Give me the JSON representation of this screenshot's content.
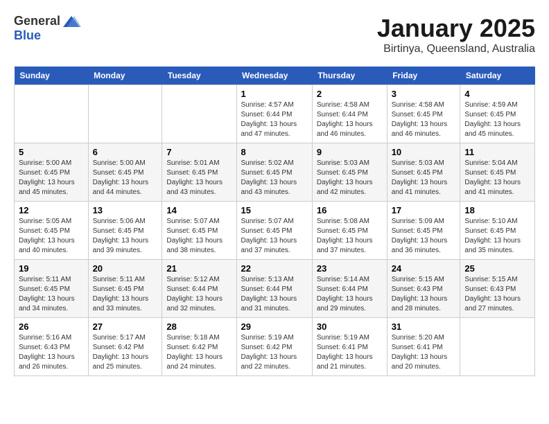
{
  "logo": {
    "general": "General",
    "blue": "Blue"
  },
  "title": "January 2025",
  "subtitle": "Birtinya, Queensland, Australia",
  "weekdays": [
    "Sunday",
    "Monday",
    "Tuesday",
    "Wednesday",
    "Thursday",
    "Friday",
    "Saturday"
  ],
  "weeks": [
    [
      {
        "day": "",
        "info": ""
      },
      {
        "day": "",
        "info": ""
      },
      {
        "day": "",
        "info": ""
      },
      {
        "day": "1",
        "info": "Sunrise: 4:57 AM\nSunset: 6:44 PM\nDaylight: 13 hours and 47 minutes."
      },
      {
        "day": "2",
        "info": "Sunrise: 4:58 AM\nSunset: 6:44 PM\nDaylight: 13 hours and 46 minutes."
      },
      {
        "day": "3",
        "info": "Sunrise: 4:58 AM\nSunset: 6:45 PM\nDaylight: 13 hours and 46 minutes."
      },
      {
        "day": "4",
        "info": "Sunrise: 4:59 AM\nSunset: 6:45 PM\nDaylight: 13 hours and 45 minutes."
      }
    ],
    [
      {
        "day": "5",
        "info": "Sunrise: 5:00 AM\nSunset: 6:45 PM\nDaylight: 13 hours and 45 minutes."
      },
      {
        "day": "6",
        "info": "Sunrise: 5:00 AM\nSunset: 6:45 PM\nDaylight: 13 hours and 44 minutes."
      },
      {
        "day": "7",
        "info": "Sunrise: 5:01 AM\nSunset: 6:45 PM\nDaylight: 13 hours and 43 minutes."
      },
      {
        "day": "8",
        "info": "Sunrise: 5:02 AM\nSunset: 6:45 PM\nDaylight: 13 hours and 43 minutes."
      },
      {
        "day": "9",
        "info": "Sunrise: 5:03 AM\nSunset: 6:45 PM\nDaylight: 13 hours and 42 minutes."
      },
      {
        "day": "10",
        "info": "Sunrise: 5:03 AM\nSunset: 6:45 PM\nDaylight: 13 hours and 41 minutes."
      },
      {
        "day": "11",
        "info": "Sunrise: 5:04 AM\nSunset: 6:45 PM\nDaylight: 13 hours and 41 minutes."
      }
    ],
    [
      {
        "day": "12",
        "info": "Sunrise: 5:05 AM\nSunset: 6:45 PM\nDaylight: 13 hours and 40 minutes."
      },
      {
        "day": "13",
        "info": "Sunrise: 5:06 AM\nSunset: 6:45 PM\nDaylight: 13 hours and 39 minutes."
      },
      {
        "day": "14",
        "info": "Sunrise: 5:07 AM\nSunset: 6:45 PM\nDaylight: 13 hours and 38 minutes."
      },
      {
        "day": "15",
        "info": "Sunrise: 5:07 AM\nSunset: 6:45 PM\nDaylight: 13 hours and 37 minutes."
      },
      {
        "day": "16",
        "info": "Sunrise: 5:08 AM\nSunset: 6:45 PM\nDaylight: 13 hours and 37 minutes."
      },
      {
        "day": "17",
        "info": "Sunrise: 5:09 AM\nSunset: 6:45 PM\nDaylight: 13 hours and 36 minutes."
      },
      {
        "day": "18",
        "info": "Sunrise: 5:10 AM\nSunset: 6:45 PM\nDaylight: 13 hours and 35 minutes."
      }
    ],
    [
      {
        "day": "19",
        "info": "Sunrise: 5:11 AM\nSunset: 6:45 PM\nDaylight: 13 hours and 34 minutes."
      },
      {
        "day": "20",
        "info": "Sunrise: 5:11 AM\nSunset: 6:45 PM\nDaylight: 13 hours and 33 minutes."
      },
      {
        "day": "21",
        "info": "Sunrise: 5:12 AM\nSunset: 6:44 PM\nDaylight: 13 hours and 32 minutes."
      },
      {
        "day": "22",
        "info": "Sunrise: 5:13 AM\nSunset: 6:44 PM\nDaylight: 13 hours and 31 minutes."
      },
      {
        "day": "23",
        "info": "Sunrise: 5:14 AM\nSunset: 6:44 PM\nDaylight: 13 hours and 29 minutes."
      },
      {
        "day": "24",
        "info": "Sunrise: 5:15 AM\nSunset: 6:43 PM\nDaylight: 13 hours and 28 minutes."
      },
      {
        "day": "25",
        "info": "Sunrise: 5:15 AM\nSunset: 6:43 PM\nDaylight: 13 hours and 27 minutes."
      }
    ],
    [
      {
        "day": "26",
        "info": "Sunrise: 5:16 AM\nSunset: 6:43 PM\nDaylight: 13 hours and 26 minutes."
      },
      {
        "day": "27",
        "info": "Sunrise: 5:17 AM\nSunset: 6:42 PM\nDaylight: 13 hours and 25 minutes."
      },
      {
        "day": "28",
        "info": "Sunrise: 5:18 AM\nSunset: 6:42 PM\nDaylight: 13 hours and 24 minutes."
      },
      {
        "day": "29",
        "info": "Sunrise: 5:19 AM\nSunset: 6:42 PM\nDaylight: 13 hours and 22 minutes."
      },
      {
        "day": "30",
        "info": "Sunrise: 5:19 AM\nSunset: 6:41 PM\nDaylight: 13 hours and 21 minutes."
      },
      {
        "day": "31",
        "info": "Sunrise: 5:20 AM\nSunset: 6:41 PM\nDaylight: 13 hours and 20 minutes."
      },
      {
        "day": "",
        "info": ""
      }
    ]
  ]
}
